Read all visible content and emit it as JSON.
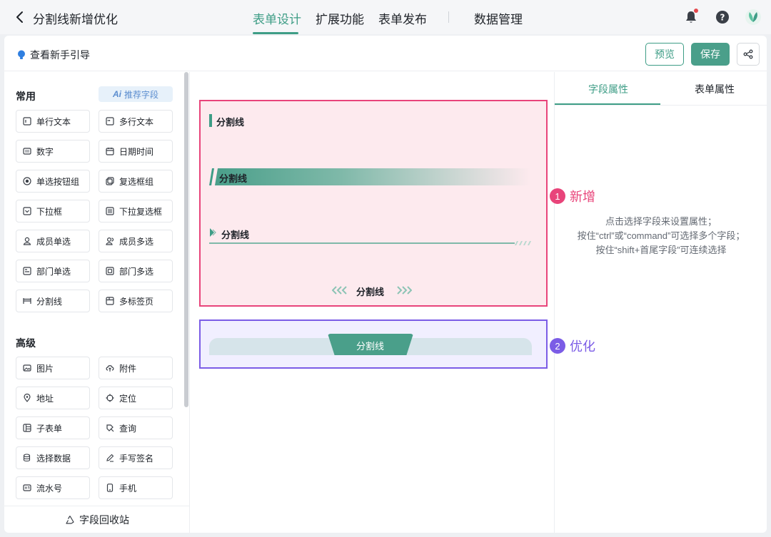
{
  "header": {
    "title": "分割线新增优化",
    "tabs": [
      {
        "label": "表单设计",
        "active": true
      },
      {
        "label": "扩展功能",
        "active": false
      },
      {
        "label": "表单发布",
        "active": false
      },
      {
        "label": "数据管理",
        "active": false
      }
    ],
    "icons": [
      "bell-icon",
      "help-icon",
      "logo-icon"
    ]
  },
  "toolbar": {
    "guide_label": "查看新手引导",
    "preview_label": "预览",
    "save_label": "保存",
    "share_icon": "share-icon"
  },
  "fields": {
    "common_title": "常用",
    "ai_label": "推荐字段",
    "ai_badge": "Ai",
    "common": [
      {
        "label": "单行文本",
        "icon": "single-line-text-icon"
      },
      {
        "label": "多行文本",
        "icon": "multi-line-text-icon"
      },
      {
        "label": "数字",
        "icon": "number-icon"
      },
      {
        "label": "日期时间",
        "icon": "calendar-icon"
      },
      {
        "label": "单选按钮组",
        "icon": "radio-icon"
      },
      {
        "label": "复选框组",
        "icon": "checkbox-icon"
      },
      {
        "label": "下拉框",
        "icon": "dropdown-icon"
      },
      {
        "label": "下拉复选框",
        "icon": "multi-dropdown-icon"
      },
      {
        "label": "成员单选",
        "icon": "member-icon"
      },
      {
        "label": "成员多选",
        "icon": "members-icon"
      },
      {
        "label": "部门单选",
        "icon": "department-icon"
      },
      {
        "label": "部门多选",
        "icon": "departments-icon"
      },
      {
        "label": "分割线",
        "icon": "divider-icon"
      },
      {
        "label": "多标签页",
        "icon": "tabs-icon"
      }
    ],
    "advanced_title": "高级",
    "advanced": [
      {
        "label": "图片",
        "icon": "image-icon"
      },
      {
        "label": "附件",
        "icon": "attachment-icon"
      },
      {
        "label": "地址",
        "icon": "location-pin-icon"
      },
      {
        "label": "定位",
        "icon": "crosshair-icon"
      },
      {
        "label": "子表单",
        "icon": "subform-icon"
      },
      {
        "label": "查询",
        "icon": "query-icon"
      },
      {
        "label": "选择数据",
        "icon": "database-icon"
      },
      {
        "label": "手写签名",
        "icon": "pen-icon"
      },
      {
        "label": "流水号",
        "icon": "serial-number-icon"
      },
      {
        "label": "手机",
        "icon": "phone-icon"
      }
    ],
    "recycle_label": "字段回收站"
  },
  "canvas": {
    "new_dividers": [
      {
        "label": "分割线",
        "style": "left-bar"
      },
      {
        "label": "分割线",
        "style": "gradient-banner"
      },
      {
        "label": "分割线",
        "style": "arrow-underline"
      },
      {
        "label": "分割线",
        "style": "centered-chevrons"
      }
    ],
    "optimized_divider": {
      "label": "分割线",
      "style": "tab-on-band"
    }
  },
  "right_panel": {
    "tabs": [
      {
        "label": "字段属性",
        "active": true
      },
      {
        "label": "表单属性",
        "active": false
      }
    ],
    "hint_lines": [
      "点击选择字段来设置属性；",
      "按住“ctrl”或“command”可选择多个字段；",
      "按住“shift+首尾字段”可连续选择"
    ]
  },
  "callouts": [
    {
      "num": "1",
      "label": "新增",
      "color": "#e8447a"
    },
    {
      "num": "2",
      "label": "优化",
      "color": "#7b5ce6"
    }
  ],
  "colors": {
    "accent": "#3e9d86",
    "new_border": "#e8447a",
    "optimize_border": "#7b5ce6"
  }
}
